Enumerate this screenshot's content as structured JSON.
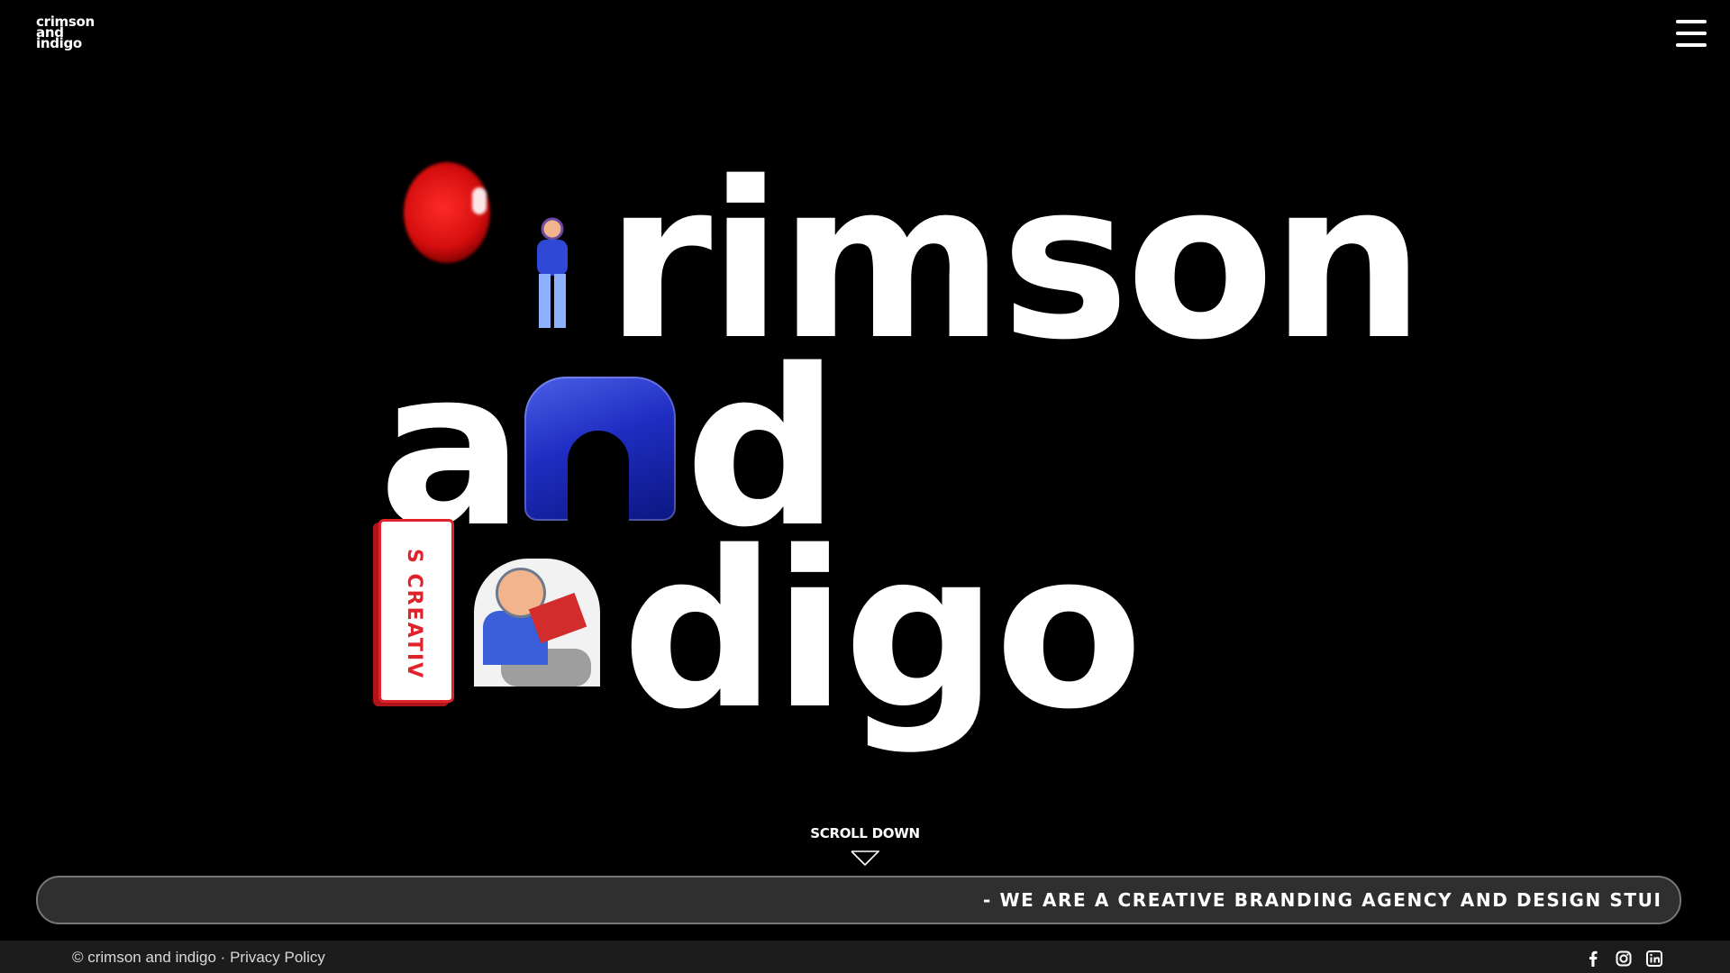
{
  "header": {
    "logo_lines": [
      "crimson",
      "and",
      "indigo"
    ],
    "menu_icon": "hamburger-menu-icon"
  },
  "hero": {
    "line1_visible": "rimson",
    "line2_part1": "a",
    "line2_part2": "d",
    "line3_visible": "digo",
    "sign_text": "S CREATIV",
    "decor": {
      "c": "red-blob-letter-c",
      "r": "girl-figure-letter-r",
      "n": "blue-blob-letter-n",
      "i": "red-sign-letter-i",
      "n2": "boy-reading-letter-n"
    }
  },
  "scroll": {
    "label": "SCROLL DOWN",
    "icon": "chevron-down-icon"
  },
  "ticker": {
    "text": "- WE ARE A CREATIVE BRANDING AGENCY AND DESIGN STUI"
  },
  "footer": {
    "copyright": "© crimson and indigo",
    "separator": " · ",
    "privacy_label": "Privacy Policy",
    "social_icons": [
      "facebook-icon",
      "instagram-icon",
      "linkedin-icon"
    ]
  }
}
